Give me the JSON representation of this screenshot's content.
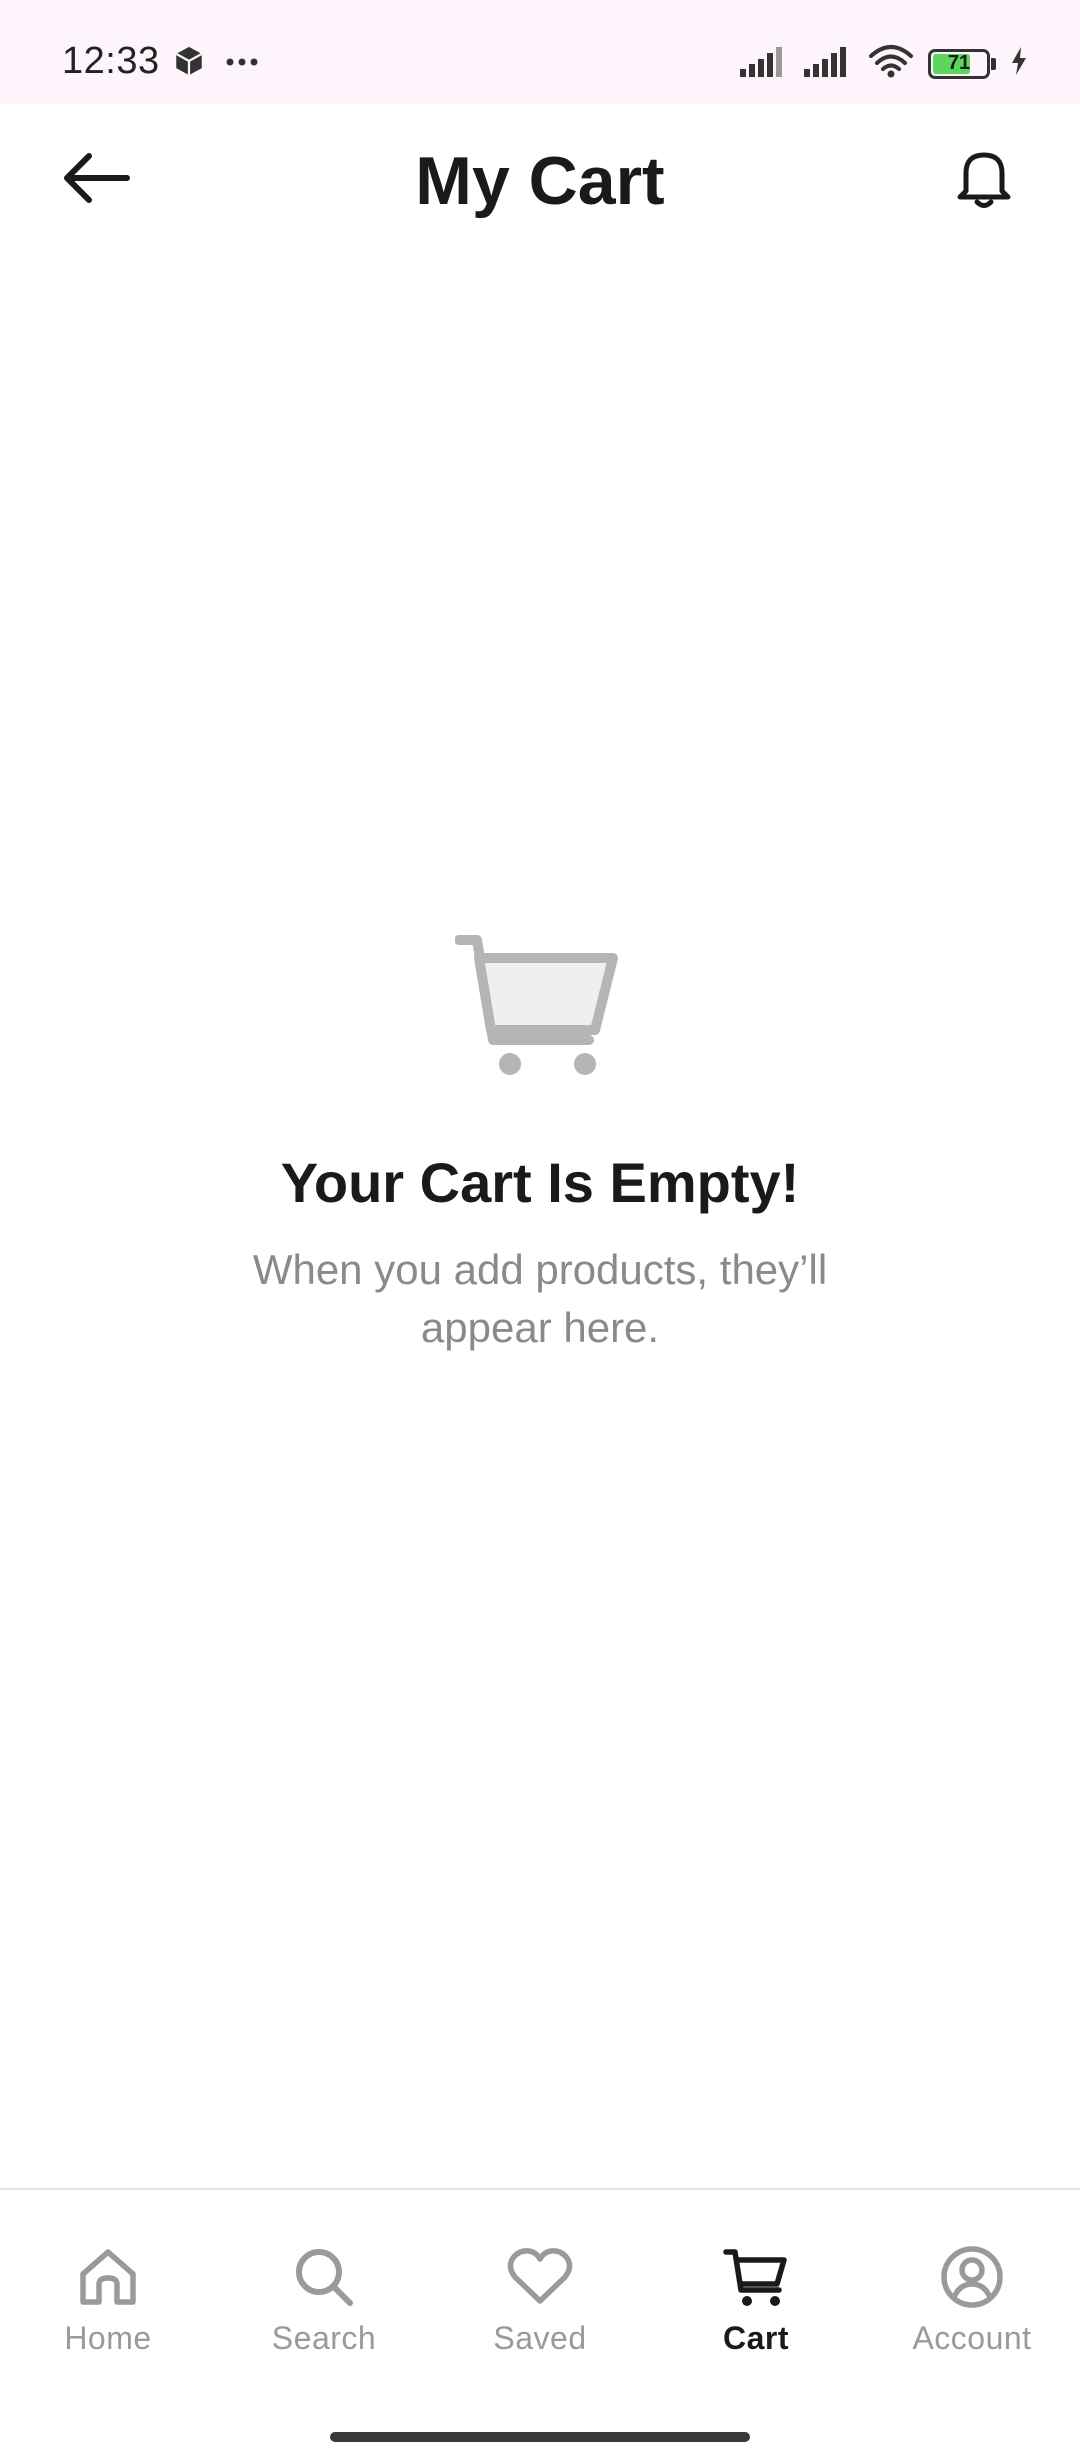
{
  "status_bar": {
    "time": "12:33",
    "battery_level": "71",
    "battery_fraction": 0.71,
    "icons": [
      "cube-icon",
      "more-dots-icon",
      "signal-icon",
      "signal-icon",
      "wifi-icon",
      "battery-icon",
      "charging-icon"
    ]
  },
  "header": {
    "title": "My Cart",
    "back_icon": "arrow-left-icon",
    "bell_icon": "bell-icon"
  },
  "empty_state": {
    "icon": "cart-icon",
    "title": "Your Cart Is Empty!",
    "subtitle": "When you add products, they’ll appear here."
  },
  "bottom_nav": {
    "items": [
      {
        "label": "Home",
        "icon": "home-icon",
        "active": false
      },
      {
        "label": "Search",
        "icon": "search-icon",
        "active": false
      },
      {
        "label": "Saved",
        "icon": "heart-icon",
        "active": false
      },
      {
        "label": "Cart",
        "icon": "cart-icon",
        "active": true
      },
      {
        "label": "Account",
        "icon": "account-icon",
        "active": false
      }
    ]
  },
  "colors": {
    "status_bar_bg": "#fdf5fb",
    "active": "#1a1a1a",
    "inactive": "#9a9a9a",
    "empty_icon": "#b5b5b5",
    "battery_fill": "#5cd65c"
  }
}
